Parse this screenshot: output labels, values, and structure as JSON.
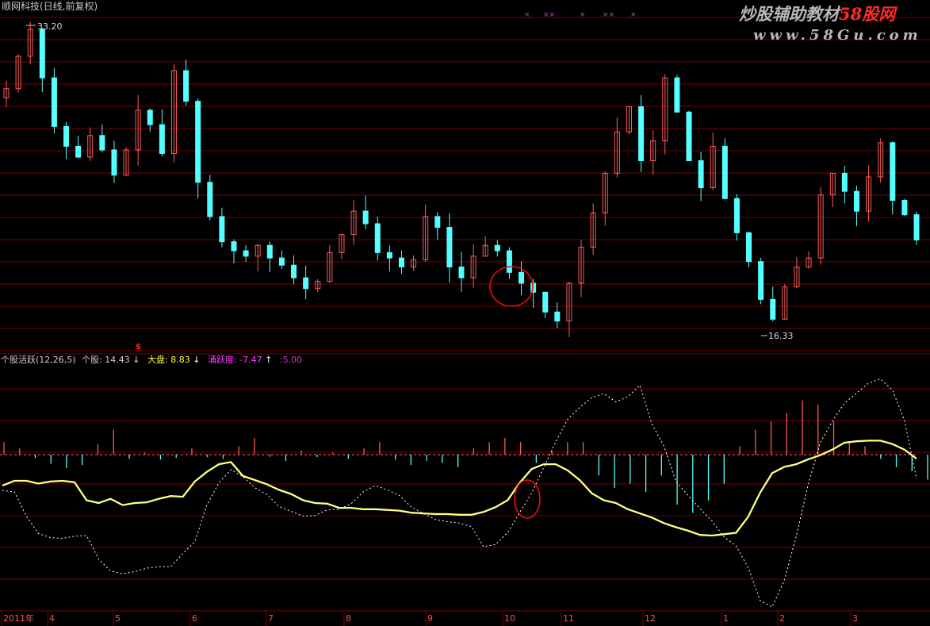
{
  "header": {
    "title": "顺网科技(日线,前复权)"
  },
  "watermark": {
    "line1_prefix": "炒股辅助教材",
    "line1_suffix": "58股网",
    "line2": "www.58Gu.com"
  },
  "price_chart": {
    "max_label": "33.20",
    "min_label": "16.33",
    "top_markers": [
      "×",
      "××",
      "×",
      "××",
      "×"
    ]
  },
  "indicator": {
    "name": "个股活跃(12,26,5)",
    "stock_label": "个股:",
    "stock_value": "14.43",
    "stock_arrow": "↓",
    "market_label": "大盘:",
    "market_value": "8.83",
    "market_arrow": "↓",
    "lead_label": "涌跃度:",
    "lead_value": "-7.47",
    "lead_arrow": "↑",
    "extra_value": ":5.00",
    "flag": "$"
  },
  "x_axis": {
    "labels": [
      "2011年",
      "4",
      "5",
      "6",
      "7",
      "8",
      "9",
      "10",
      "11",
      "12",
      "1",
      "2",
      "3"
    ]
  },
  "colors": {
    "background": "#000000",
    "up": "#ff5a5a",
    "down": "#54ffff",
    "grid": "#7a0000",
    "yellow_line": "#ffff80",
    "white_line": "#ffffff",
    "title_text": "#c0c0c0",
    "label_magenta": "#ff40ff",
    "label_yellow": "#ffff00",
    "watermark": "#b0b0b0",
    "watermark_red": "#ff2020"
  },
  "chart_data": {
    "type": "line",
    "price_range": [
      16.33,
      33.2
    ],
    "close": [
      29.6,
      31.4,
      32.9,
      30.2,
      27.5,
      26.4,
      25.8,
      27.0,
      26.2,
      24.8,
      26.2,
      28.4,
      27.6,
      26.0,
      30.6,
      28.9,
      24.4,
      22.5,
      21.1,
      20.6,
      20.3,
      20.9,
      20.2,
      19.8,
      19.1,
      18.5,
      18.9,
      20.5,
      21.5,
      22.8,
      22.1,
      20.5,
      20.2,
      19.7,
      20.1,
      22.5,
      21.9,
      19.7,
      19.1,
      20.3,
      20.9,
      20.6,
      19.4,
      18.8,
      18.3,
      17.2,
      16.7,
      18.8,
      20.8,
      22.7,
      24.9,
      27.2,
      28.6,
      25.6,
      26.7,
      30.2,
      28.3,
      25.6,
      24.1,
      26.4,
      23.5,
      21.6,
      20.0,
      17.9,
      16.8,
      18.6,
      19.7,
      20.2,
      23.7,
      24.9,
      23.9,
      22.8,
      24.7,
      26.6,
      23.4,
      22.6,
      21.2
    ],
    "indicator_range": [
      -18,
      16
    ],
    "stock_activity": [
      -0.5,
      0.2,
      0.2,
      -0.2,
      0.1,
      0.2,
      0.0,
      -2.6,
      -3.0,
      -2.4,
      -3.3,
      -3.0,
      -2.9,
      -2.4,
      -2.0,
      -2.1,
      0.1,
      1.5,
      2.6,
      2.9,
      0.9,
      0.3,
      -0.3,
      -1.1,
      -1.7,
      -2.6,
      -3.0,
      -3.1,
      -3.7,
      -3.7,
      -3.9,
      -3.9,
      -4.0,
      -4.1,
      -4.4,
      -4.5,
      -4.6,
      -4.6,
      -4.7,
      -4.7,
      -4.3,
      -3.6,
      -2.6,
      -0.1,
      1.9,
      2.6,
      2.6,
      1.7,
      0.3,
      -1.6,
      -2.6,
      -3.0,
      -3.9,
      -4.5,
      -5.1,
      -5.9,
      -6.5,
      -7.0,
      -7.6,
      -7.7,
      -7.5,
      -7.3,
      -5.0,
      -1.5,
      1.3,
      2.2,
      2.6,
      3.3,
      3.9,
      4.7,
      5.7,
      5.9,
      6.0,
      6.0,
      5.5,
      4.7,
      3.4
    ],
    "market_activity": [
      -1.2,
      -1.4,
      -4.9,
      -7.4,
      -8.0,
      -8.1,
      -7.8,
      -7.7,
      -11.1,
      -12.8,
      -13.2,
      -12.9,
      -12.4,
      -12.2,
      -12.2,
      -10.3,
      -8.6,
      -3.3,
      -0.1,
      1.8,
      0.8,
      -0.8,
      -1.8,
      -3.5,
      -4.2,
      -4.9,
      -4.8,
      -4.0,
      -3.9,
      -3.1,
      -1.4,
      -0.5,
      -1.1,
      -1.9,
      -3.6,
      -4.5,
      -5.4,
      -5.7,
      -5.9,
      -6.4,
      -9.3,
      -9.0,
      -7.3,
      -4.4,
      -1.6,
      2.1,
      5.8,
      9.1,
      10.8,
      12.2,
      12.8,
      11.6,
      12.3,
      14.0,
      8.4,
      5.2,
      0.1,
      -1.9,
      -3.8,
      -5.6,
      -7.9,
      -9.2,
      -12.3,
      -17.1,
      -18.0,
      -14.2,
      -7.8,
      -0.3,
      5.7,
      8.8,
      11.4,
      12.8,
      14.3,
      14.9,
      13.3,
      8.9,
      0.5
    ],
    "difference_bars": [
      3,
      1.5,
      -0.8,
      -2.2,
      -3.2,
      -2.5,
      2.5,
      6,
      -1,
      0.5,
      -1.2,
      -0.8,
      1.5,
      -0.6,
      -1,
      2,
      4,
      -0.5,
      -1.5,
      1,
      -0.6,
      0.5,
      -1,
      1.5,
      3,
      -1.2,
      -2.5,
      -1.5,
      -2,
      -3,
      1.5,
      3,
      4,
      3,
      -2,
      1,
      3,
      3,
      -5,
      -8,
      -7,
      -9,
      -5,
      -12,
      -14,
      -11,
      -7,
      2,
      6,
      8,
      10,
      13,
      12,
      8,
      3,
      2,
      -1,
      -3,
      -4,
      -6
    ],
    "difference_range": [
      -20,
      20
    ],
    "reference_level": 0,
    "xlabel": "",
    "ylabel": ""
  }
}
